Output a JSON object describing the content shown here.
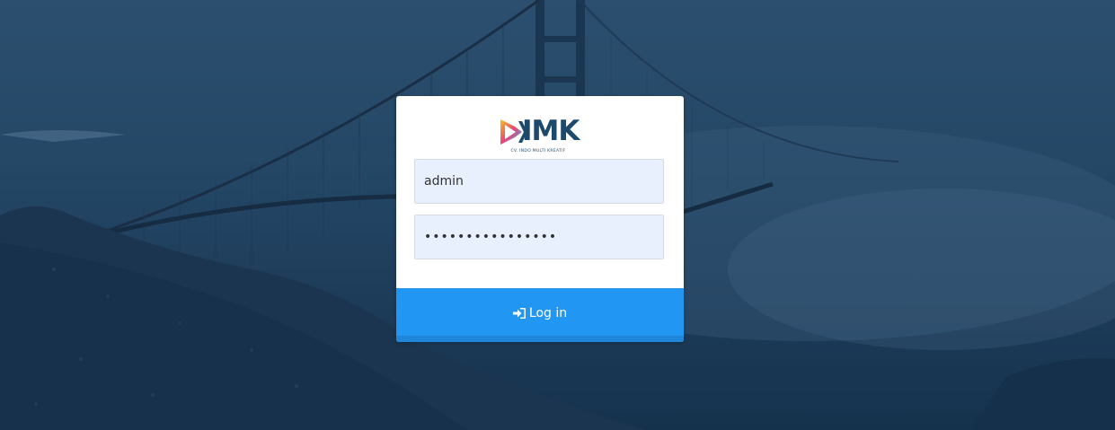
{
  "logo": {
    "text": "IMK",
    "tagline": "CV. INDO MULTI KREATIF"
  },
  "form": {
    "username_value": "admin",
    "password_value": "••••••••••••••••"
  },
  "login_button": {
    "label": "Log in",
    "icon": "sign-in-icon"
  },
  "colors": {
    "button": "#2196f3",
    "field_bg": "#e8f0fe",
    "logo_dark": "#1d4a6b"
  }
}
